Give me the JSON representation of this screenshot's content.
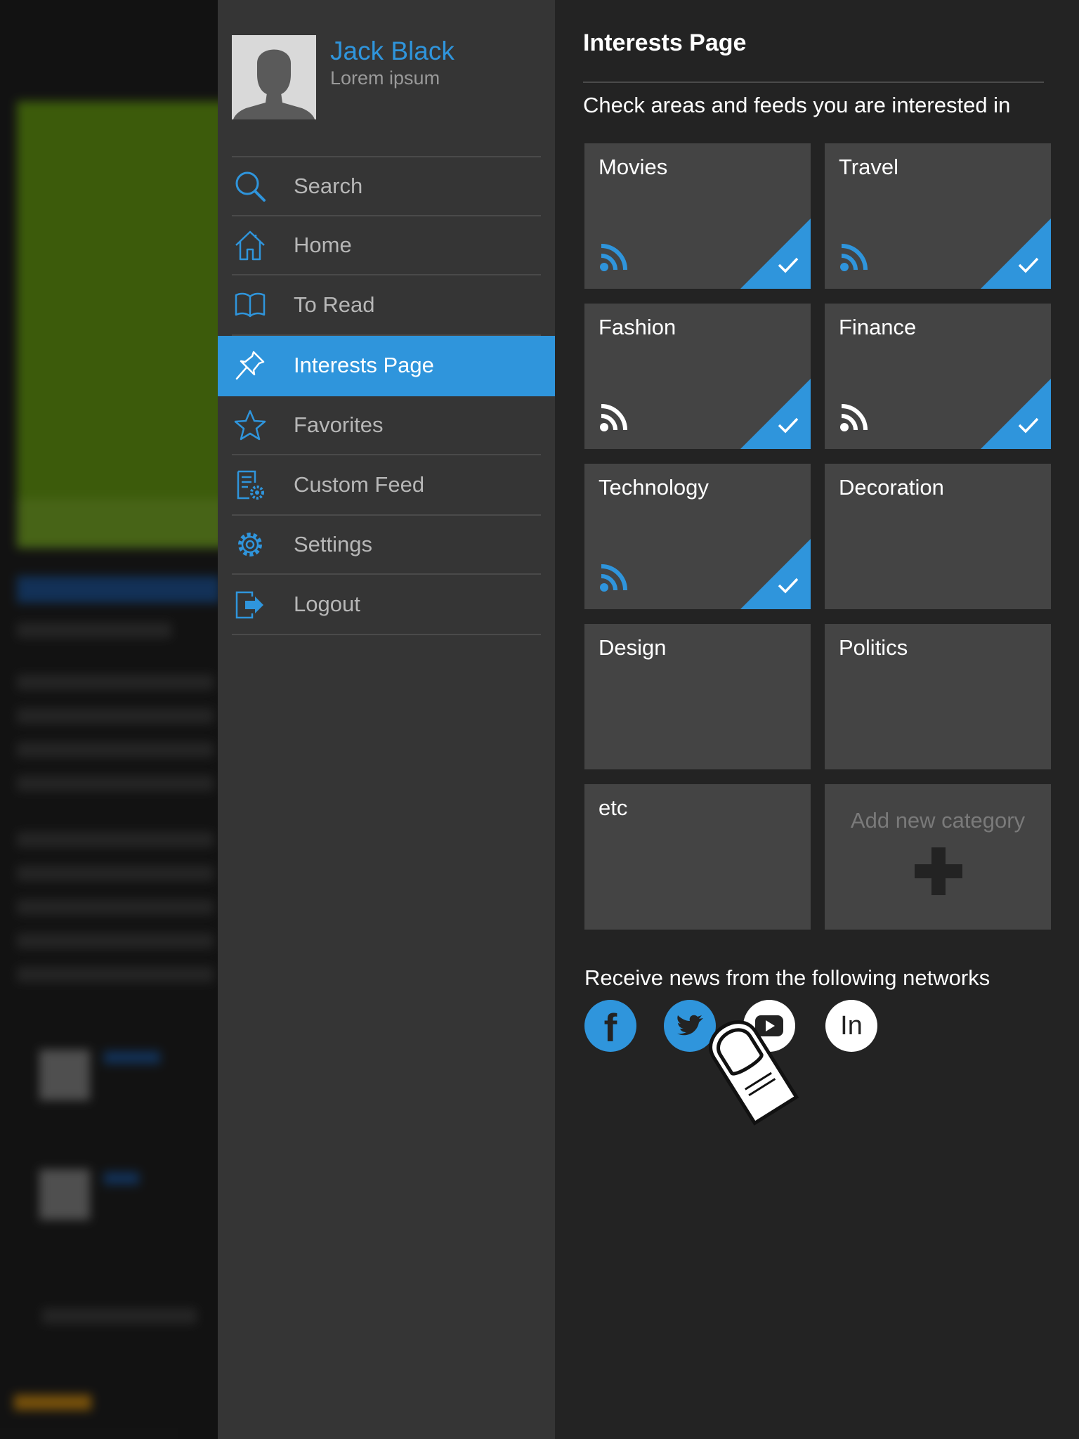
{
  "profile": {
    "name": "Jack Black",
    "subtitle": "Lorem ipsum"
  },
  "menu": {
    "items": [
      {
        "label": "Search",
        "icon": "search-icon",
        "active": false
      },
      {
        "label": "Home",
        "icon": "home-icon",
        "active": false
      },
      {
        "label": "To Read",
        "icon": "book-icon",
        "active": false
      },
      {
        "label": "Interests Page",
        "icon": "pin-icon",
        "active": true
      },
      {
        "label": "Favorites",
        "icon": "star-icon",
        "active": false
      },
      {
        "label": "Custom Feed",
        "icon": "custom-feed-icon",
        "active": false
      },
      {
        "label": "Settings",
        "icon": "gear-icon",
        "active": false
      },
      {
        "label": "Logout",
        "icon": "logout-icon",
        "active": false
      }
    ]
  },
  "interests": {
    "title": "Interests Page",
    "subtitle": "Check areas and feeds you are interested in",
    "categories": [
      {
        "label": "Movies",
        "checked": true,
        "rss_color": "blue"
      },
      {
        "label": "Travel",
        "checked": true,
        "rss_color": "blue"
      },
      {
        "label": "Fashion",
        "checked": true,
        "rss_color": "white"
      },
      {
        "label": "Finance",
        "checked": true,
        "rss_color": "white"
      },
      {
        "label": "Technology",
        "checked": true,
        "rss_color": "blue"
      },
      {
        "label": "Decoration",
        "checked": false
      },
      {
        "label": "Design",
        "checked": false
      },
      {
        "label": "Politics",
        "checked": false
      },
      {
        "label": "etc",
        "checked": false
      }
    ],
    "add_category_label": "Add new category"
  },
  "networks": {
    "label": "Receive news from the following networks",
    "items": [
      {
        "name": "facebook-icon",
        "glyph": "f",
        "selected": true
      },
      {
        "name": "twitter-icon",
        "selected": true
      },
      {
        "name": "youtube-icon",
        "selected": false
      },
      {
        "name": "linkedin-icon",
        "glyph": "In",
        "selected": false
      }
    ]
  },
  "colors": {
    "accent": "#2f95dc",
    "sidebar_bg": "#353535",
    "panel_bg": "#232323",
    "tile_bg": "#444444"
  }
}
